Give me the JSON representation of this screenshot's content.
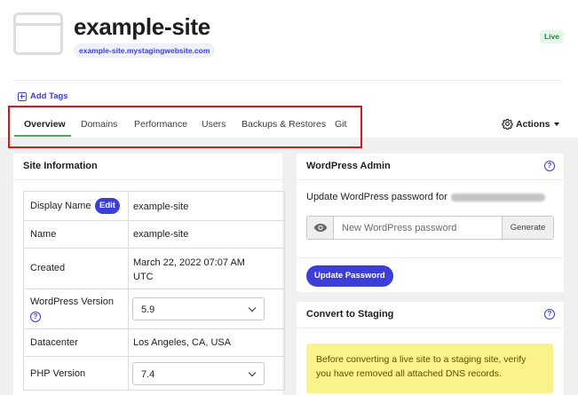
{
  "header": {
    "site_name": "example-site",
    "domain": "example-site.mystagingwebsite.com",
    "status": "Live",
    "add_tags_label": "Add Tags"
  },
  "tabs": [
    {
      "label": "Overview",
      "active": true
    },
    {
      "label": "Domains",
      "active": false
    },
    {
      "label": "Performance",
      "active": false
    },
    {
      "label": "Users",
      "active": false
    },
    {
      "label": "Backups & Restores",
      "active": false
    },
    {
      "label": "Git",
      "active": false
    }
  ],
  "actions_label": "Actions",
  "site_info": {
    "title": "Site Information",
    "edit_label": "Edit",
    "rows": [
      {
        "label": "Display Name",
        "value": "example-site"
      },
      {
        "label": "Name",
        "value": "example-site"
      },
      {
        "label": "Created",
        "value": "March 22, 2022 07:07 AM UTC"
      },
      {
        "label": "WordPress Version",
        "value": "5.9"
      },
      {
        "label": "Datacenter",
        "value": "Los Angeles, CA, USA"
      },
      {
        "label": "PHP Version",
        "value": "7.4"
      }
    ]
  },
  "wp_admin": {
    "title": "WordPress Admin",
    "prompt": "Update WordPress password for",
    "password_placeholder": "New WordPress password",
    "generate_label": "Generate",
    "update_label": "Update Password"
  },
  "convert": {
    "title": "Convert to Staging",
    "notice": "Before converting a live site to a staging site, verify you have removed all attached DNS records."
  },
  "colors": {
    "accent": "#3b3fd8",
    "live_badge_bg": "#e6f6ea",
    "live_badge_text": "#1e8a3c",
    "highlight_box": "#e0141c",
    "active_tab_underline": "#3bb54a",
    "notice_bg": "#faf28a"
  },
  "icons": [
    "site-thumbnail-icon",
    "add-tags-plus-icon",
    "gear-icon",
    "help-icon",
    "eye-icon"
  ]
}
